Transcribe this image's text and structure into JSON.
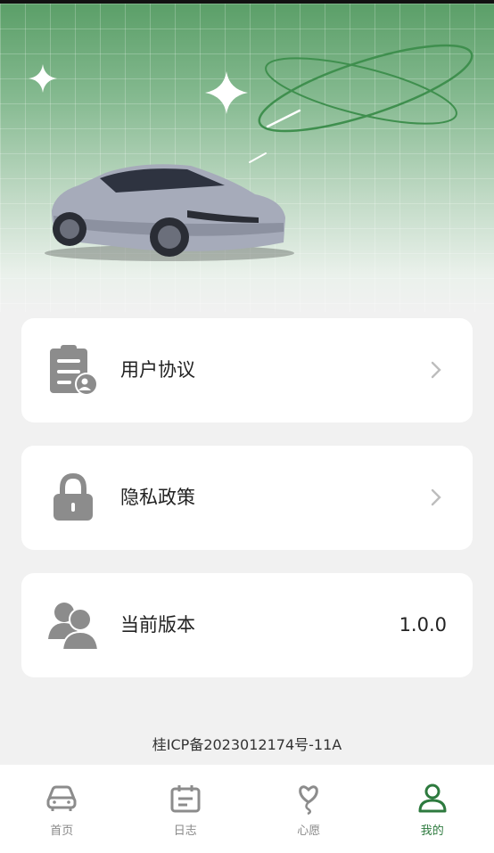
{
  "menu": [
    {
      "label": "用户协议",
      "icon": "agreement-clipboard-icon"
    },
    {
      "label": "隐私政策",
      "icon": "lock-icon"
    },
    {
      "label": "当前版本",
      "icon": "users-icon",
      "value": "1.0.0"
    }
  ],
  "footer": {
    "icp": "桂ICP备2023012174号-11A"
  },
  "nav": {
    "items": [
      {
        "label": "首页",
        "icon": "car-icon"
      },
      {
        "label": "日志",
        "icon": "calendar-icon"
      },
      {
        "label": "心愿",
        "icon": "balloon-icon"
      },
      {
        "label": "我的",
        "icon": "person-icon"
      }
    ],
    "active_index": 3
  },
  "colors": {
    "accent": "#2d7a3e",
    "hero_top": "#5b9f68",
    "background": "#f1f1f1",
    "icon_gray": "#8c8c8c"
  }
}
